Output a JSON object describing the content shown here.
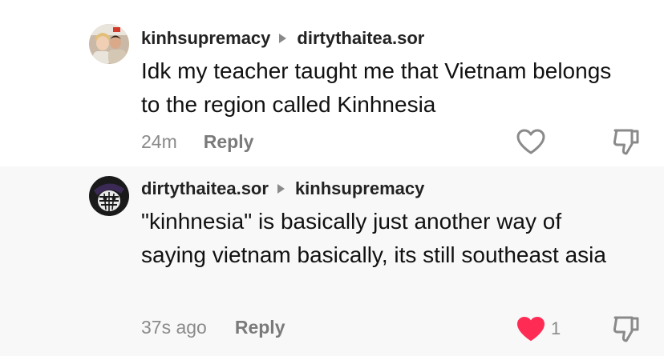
{
  "comments": [
    {
      "author": "kinhsupremacy",
      "reply_to": "dirtythaitea.sor",
      "text": "Idk my teacher taught me that Vietnam belongs to the region called Kinhnesia",
      "time": "24m",
      "reply_label": "Reply",
      "liked": false,
      "like_count": "",
      "avatar_icon": "profile-photo-two-people"
    },
    {
      "author": "dirtythaitea.sor",
      "reply_to": "kinhsupremacy",
      "text": "\"kinhnesia\" is basically just another way of saying vietnam basically, its still southeast asia",
      "time": "37s ago",
      "reply_label": "Reply",
      "liked": true,
      "like_count": "1",
      "avatar_icon": "profile-drawing-dark"
    }
  ],
  "colors": {
    "like_active": "#fe2c55",
    "icon_gray": "#8a8a8a",
    "second_bg": "#f8f8f8"
  }
}
